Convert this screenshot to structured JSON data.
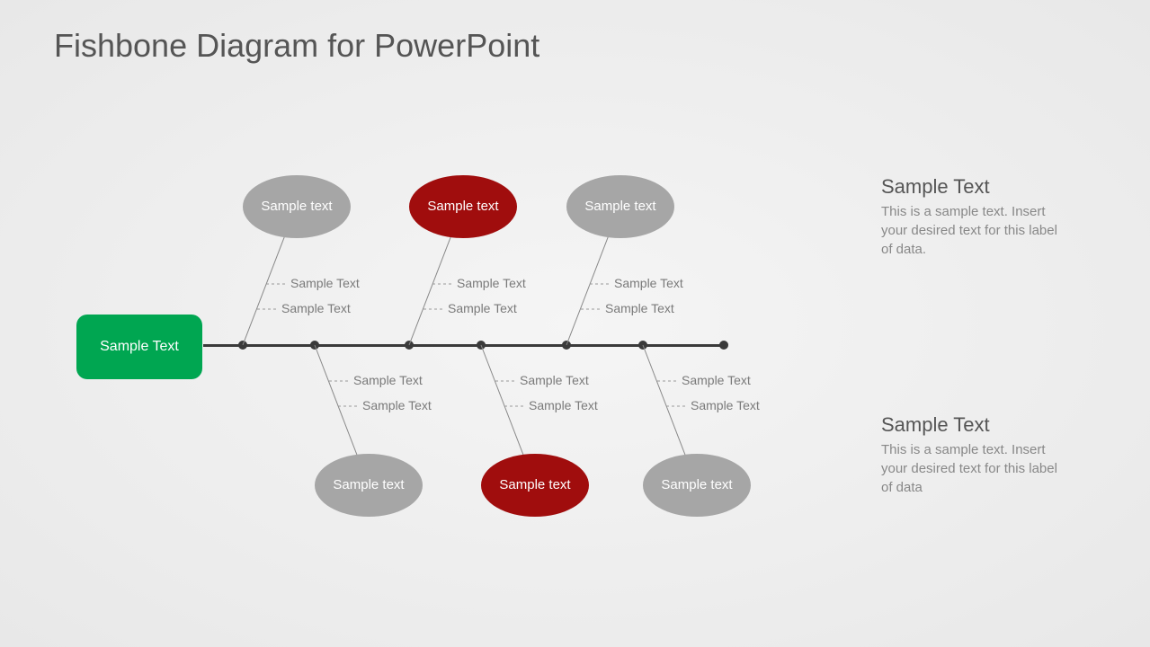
{
  "title": "Fishbone Diagram for PowerPoint",
  "head": {
    "label": "Sample Text"
  },
  "topCauses": [
    {
      "label": "Sample text",
      "color": "grey",
      "subs": [
        "Sample Text",
        "Sample Text"
      ]
    },
    {
      "label": "Sample text",
      "color": "red",
      "subs": [
        "Sample Text",
        "Sample Text"
      ]
    },
    {
      "label": "Sample text",
      "color": "grey",
      "subs": [
        "Sample Text",
        "Sample Text"
      ]
    }
  ],
  "bottomCauses": [
    {
      "label": "Sample text",
      "color": "grey",
      "subs": [
        "Sample Text",
        "Sample Text"
      ]
    },
    {
      "label": "Sample text",
      "color": "red",
      "subs": [
        "Sample Text",
        "Sample Text"
      ]
    },
    {
      "label": "Sample text",
      "color": "grey",
      "subs": [
        "Sample Text",
        "Sample Text"
      ]
    }
  ],
  "sidebar": {
    "top": {
      "title": "Sample Text",
      "body": "This is a sample text. Insert your desired text for this label of data."
    },
    "bottom": {
      "title": "Sample Text",
      "body": "This is a sample text. Insert your desired text for this label of data"
    }
  },
  "colors": {
    "green": "#00a651",
    "red": "#a00d0d",
    "grey": "#a6a6a6",
    "spine": "#3a3a3a"
  }
}
